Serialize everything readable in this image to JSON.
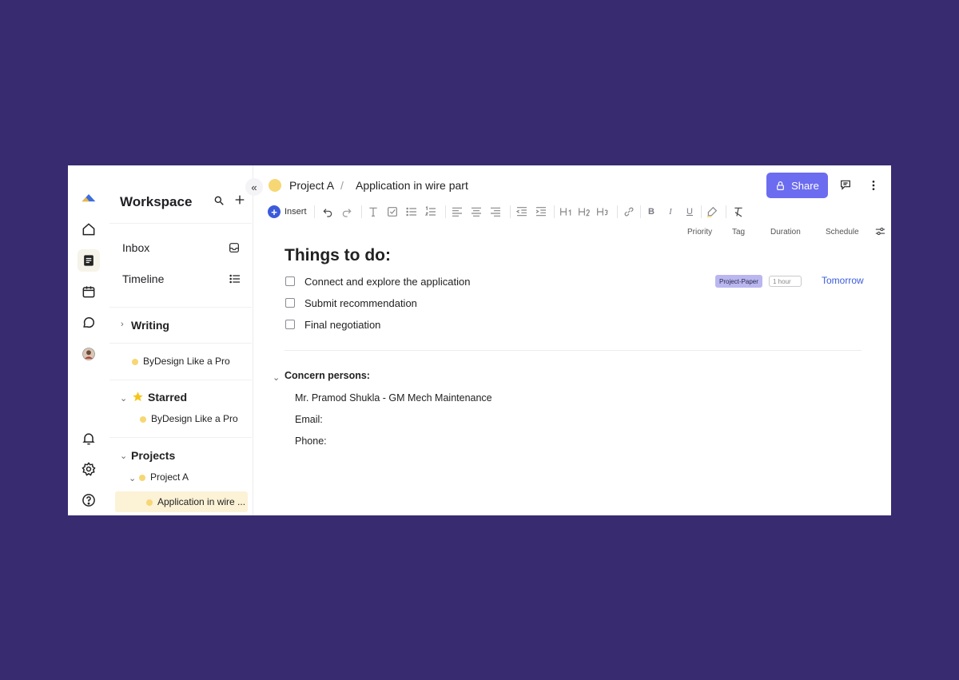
{
  "sidebar": {
    "title": "Workspace",
    "nav": {
      "inbox": "Inbox",
      "timeline": "Timeline"
    },
    "writing": {
      "label": "Writing",
      "items": [
        "ByDesign Like a Pro"
      ]
    },
    "starred": {
      "label": "Starred",
      "items": [
        "ByDesign Like a Pro"
      ]
    },
    "projects": {
      "label": "Projects",
      "project": "Project A",
      "page": "Application in wire ..."
    }
  },
  "header": {
    "breadcrumb_project": "Project A",
    "breadcrumb_separator": "/",
    "breadcrumb_page": "Application in wire part",
    "share_label": "Share"
  },
  "toolbar": {
    "insert_label": "Insert"
  },
  "columns": {
    "priority": "Priority",
    "tag": "Tag",
    "duration": "Duration",
    "schedule": "Schedule"
  },
  "document": {
    "title": "Things to do:",
    "tasks": [
      {
        "label": "Connect and explore the application",
        "tag": "Project-Paper",
        "duration": "1 hour",
        "schedule": "Tomorrow"
      },
      {
        "label": "Submit recommendation"
      },
      {
        "label": "Final negotiation"
      }
    ],
    "concern": {
      "title": "Concern persons:",
      "lines": [
        "Mr. Pramod Shukla - GM Mech Maintenance",
        "Email:",
        "Phone:"
      ]
    }
  },
  "colors": {
    "background": "#382b70",
    "accent": "#6c6cf0",
    "link": "#3b5bdb",
    "dot": "#f6d774",
    "tag": "#b9b6f0"
  }
}
